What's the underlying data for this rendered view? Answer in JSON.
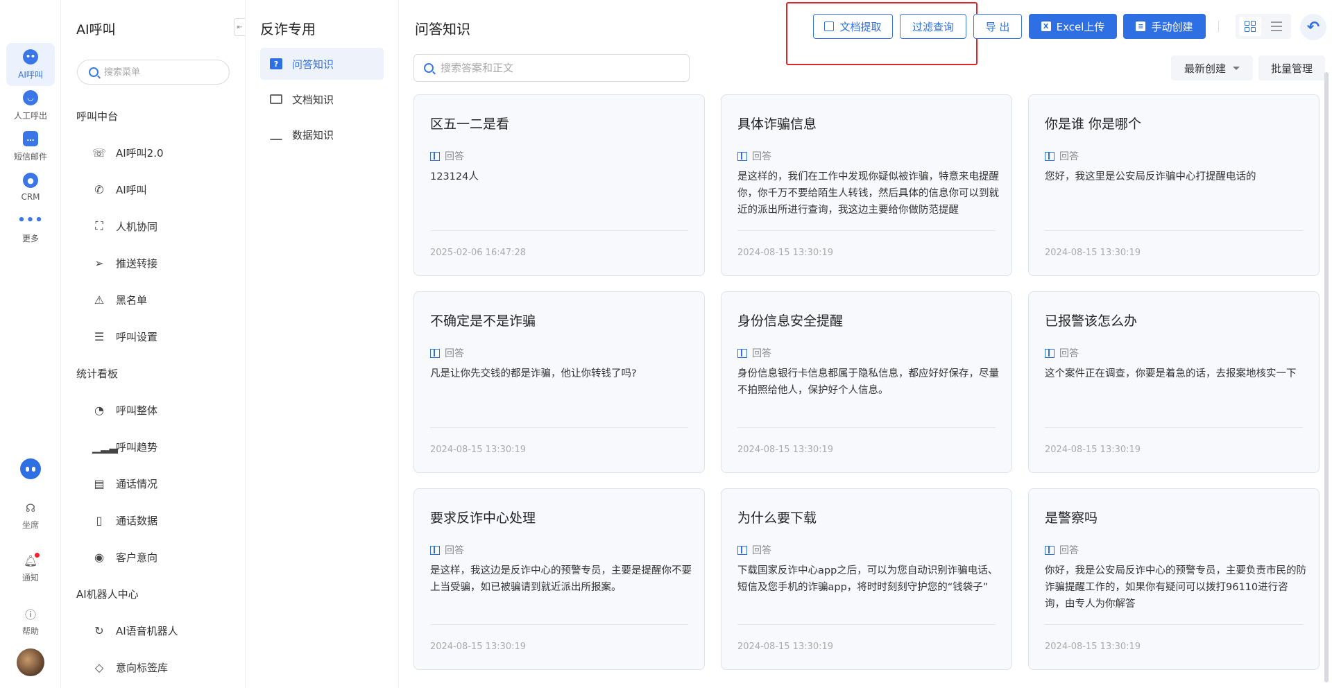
{
  "rail": {
    "items": [
      {
        "label": "AI呼叫",
        "icon": "ai-robot-icon",
        "active": true
      },
      {
        "label": "人工呼出",
        "icon": "manual-call-icon",
        "active": false
      },
      {
        "label": "短信邮件",
        "icon": "message-icon",
        "active": false
      },
      {
        "label": "CRM",
        "icon": "crm-icon",
        "active": false
      },
      {
        "label": "更多",
        "icon": "more-dots-icon",
        "active": false
      }
    ],
    "bottom": [
      {
        "label": "坐席",
        "icon": "headset-icon"
      },
      {
        "label": "通知",
        "icon": "bell-icon"
      },
      {
        "label": "帮助",
        "icon": "help-icon"
      }
    ]
  },
  "menu": {
    "title": "AI呼叫",
    "search_placeholder": "搜索菜单",
    "groups": [
      {
        "label": "呼叫中台",
        "items": [
          {
            "label": "AI呼叫2.0",
            "icon": "phone-sound-icon"
          },
          {
            "label": "AI呼叫",
            "icon": "phone-icon"
          },
          {
            "label": "人机协同",
            "icon": "scan-face-icon"
          },
          {
            "label": "推送转接",
            "icon": "send-icon"
          },
          {
            "label": "黑名单",
            "icon": "warning-icon"
          },
          {
            "label": "呼叫设置",
            "icon": "sliders-icon"
          }
        ]
      },
      {
        "label": "统计看板",
        "items": [
          {
            "label": "呼叫整体",
            "icon": "pie-chart-icon"
          },
          {
            "label": "呼叫趋势",
            "icon": "bar-chart-icon"
          },
          {
            "label": "通话情况",
            "icon": "document-icon"
          },
          {
            "label": "通话数据",
            "icon": "search-document-icon"
          },
          {
            "label": "客户意向",
            "icon": "intent-icon"
          }
        ]
      },
      {
        "label": "AI机器人中心",
        "items": [
          {
            "label": "AI语音机器人",
            "icon": "voice-bot-icon"
          },
          {
            "label": "意向标签库",
            "icon": "tag-icon"
          }
        ]
      }
    ]
  },
  "subnav": {
    "title": "反诈专用",
    "items": [
      {
        "label": "问答知识",
        "active": true
      },
      {
        "label": "文档知识",
        "active": false
      },
      {
        "label": "数据知识",
        "active": false
      }
    ]
  },
  "main": {
    "title": "问答知识",
    "toolbar": {
      "doc_extract": "文档提取",
      "filter_query": "过滤查询",
      "export": "导 出",
      "excel_upload": "Excel上传",
      "manual_create": "手动创建"
    },
    "search_placeholder": "搜索答案和正文",
    "sort_label": "最新创建",
    "batch_label": "批量管理",
    "answer_label": "回答",
    "cards": [
      {
        "title": "区五一二是看",
        "body": "123124人",
        "date": "2025-02-06 16:47:28"
      },
      {
        "title": "具体诈骗信息",
        "body": "是这样的，我们在工作中发现你疑似被诈骗，特意来电提醒你，你千万不要给陌生人转钱，然后具体的信息你可以到就近的派出所进行查询，我这边主要给你做防范提醒",
        "date": "2024-08-15 13:30:19"
      },
      {
        "title": "你是谁 你是哪个",
        "body": "您好，我这里是公安局反诈骗中心打提醒电话的",
        "date": "2024-08-15 13:30:19"
      },
      {
        "title": "不确定是不是诈骗",
        "body": "凡是让你先交钱的都是诈骗，他让你转钱了吗?",
        "date": "2024-08-15 13:30:19"
      },
      {
        "title": "身份信息安全提醒",
        "body": "身份信息银行卡信息都属于隐私信息，都应好好保存，尽量不拍照给他人，保护好个人信息。",
        "date": "2024-08-15 13:30:19"
      },
      {
        "title": "已报警该怎么办",
        "body": "这个案件正在调查，你要是着急的话，去报案地核实一下",
        "date": "2024-08-15 13:30:19"
      },
      {
        "title": "要求反诈中心处理",
        "body": "是这样，我这边是反诈中心的预警专员，主要是提醒你不要上当受骗，如已被骗请到就近派出所报案。",
        "date": "2024-08-15 13:30:19"
      },
      {
        "title": "为什么要下载",
        "body": "下载国家反诈中心app之后，可以为您自动识别诈骗电话、短信及您手机的诈骗app，将时时刻刻守护您的“钱袋子”",
        "date": "2024-08-15 13:30:19"
      },
      {
        "title": "是警察吗",
        "body": "你好，我是公安局反诈中心的预警专员，主要负责市民的防诈骗提醒工作的，如果你有疑问可以拨打96110进行咨询，由专人为你解答",
        "date": "2024-08-15 13:30:19"
      }
    ]
  },
  "colors": {
    "accent": "#2f6fe4",
    "highlight": "#e0242a"
  }
}
